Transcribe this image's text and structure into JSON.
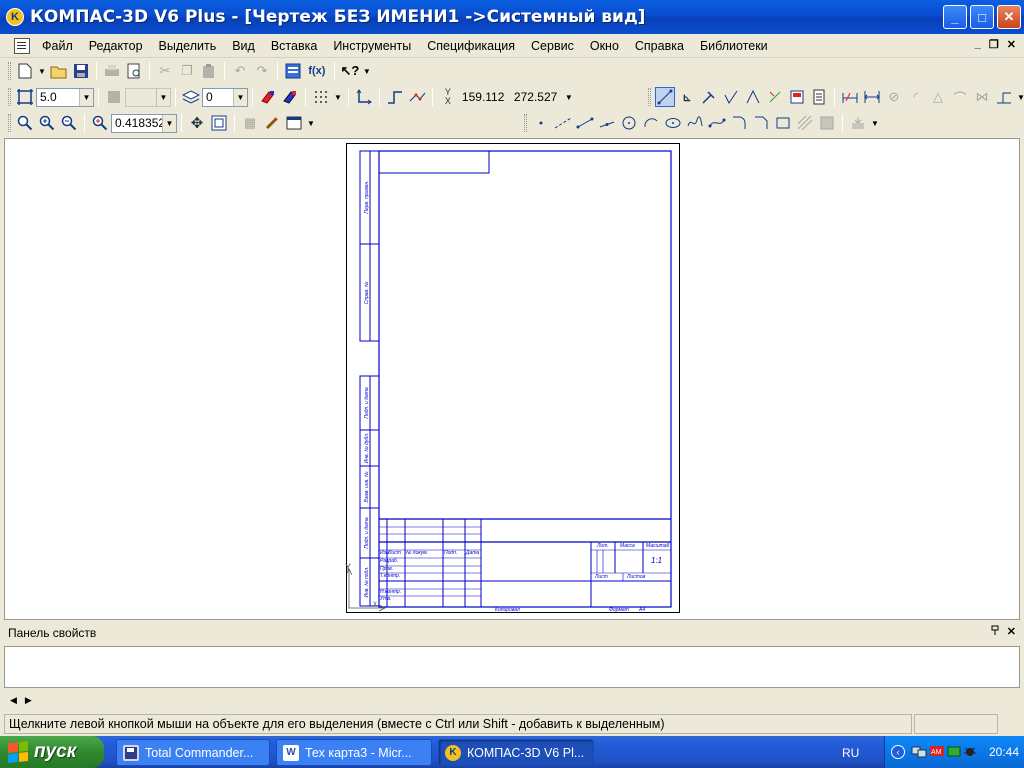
{
  "window": {
    "title": "КОМПАС-3D V6 Plus - [Чертеж БЕЗ ИМЕНИ1 ->Системный вид]",
    "minimize": "_",
    "maximize": "□",
    "close": "✕"
  },
  "menu": {
    "items": [
      "Файл",
      "Редактор",
      "Выделить",
      "Вид",
      "Вставка",
      "Инструменты",
      "Спецификация",
      "Сервис",
      "Окно",
      "Справка",
      "Библиотеки"
    ],
    "mdi_min": "_",
    "mdi_restore": "❐",
    "mdi_close": "✕"
  },
  "toolbar1": {
    "icons": [
      "new-icon",
      "open-icon",
      "save-icon",
      "print-icon",
      "preview-icon",
      "cut-icon",
      "copy-icon",
      "paste-icon",
      "undo-icon",
      "redo-icon",
      "variables-icon",
      "function-icon",
      "help-icon"
    ],
    "fx_label": "f(x)"
  },
  "toolbar2": {
    "step_value": "5.0",
    "layer_value": "",
    "state_value": "0",
    "x_coord": "159.112",
    "y_coord": "272.527"
  },
  "toolbar3": {
    "zoom_value": "0.418352"
  },
  "drawing": {
    "sheet_side_labels": [
      "Перв. примен.",
      "Справ. №",
      "Подп. и дата",
      "Инв. № дубл.",
      "Взам. инв. №",
      "Подп. и дата",
      "Инв. № подл."
    ],
    "title_block": {
      "col_labels": [
        "Изм.",
        "Лист",
        "№ докум.",
        "Подп.",
        "Дата"
      ],
      "row_labels": [
        "Разраб.",
        "Пров.",
        "Т.контр.",
        "Н.контр.",
        "Утв."
      ],
      "lit": "Лит.",
      "mass": "Масса",
      "scale": "Масштаб",
      "scale_value": "1:1",
      "sheet": "Лист",
      "sheets": "Листов",
      "copied": "Копировал",
      "format": "Формат",
      "format_value": "A4"
    },
    "axis_y": "Y",
    "axis_x": "X"
  },
  "properties_panel": {
    "title": "Панель свойств",
    "pin": "ᵽ",
    "close": "✕"
  },
  "status": {
    "text": "Щелкните левой кнопкой мыши на объекте для его выделения (вместе с Ctrl или Shift - добавить к выделенным)"
  },
  "taskbar": {
    "start_label": "пуск",
    "tasks": [
      {
        "label": "Total Commander...",
        "icon": "floppy-icon"
      },
      {
        "label": "Тех карта3 - Micr...",
        "icon": "word-icon"
      },
      {
        "label": "КОМПАС-3D V6 Pl...",
        "icon": "kompas-icon"
      }
    ],
    "lang": "RU",
    "clock": "20:44"
  }
}
